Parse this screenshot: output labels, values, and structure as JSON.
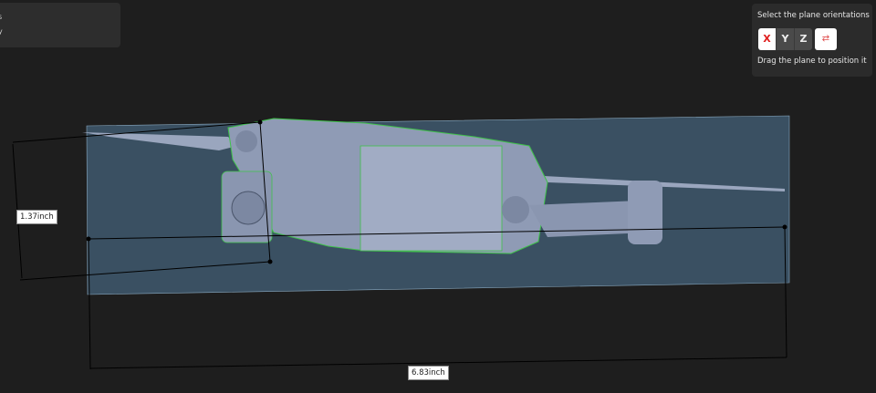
{
  "left_panel": {
    "line1": "s",
    "line2": "y"
  },
  "plane_panel": {
    "title": "Select the plane orientations",
    "axes": [
      "X",
      "Y",
      "Z"
    ],
    "flip_icon": "flip-icon",
    "hint": "Drag the plane to position it",
    "accent": "#e02020"
  },
  "dimensions": {
    "height": "1.37inch",
    "width": "6.83inch"
  }
}
